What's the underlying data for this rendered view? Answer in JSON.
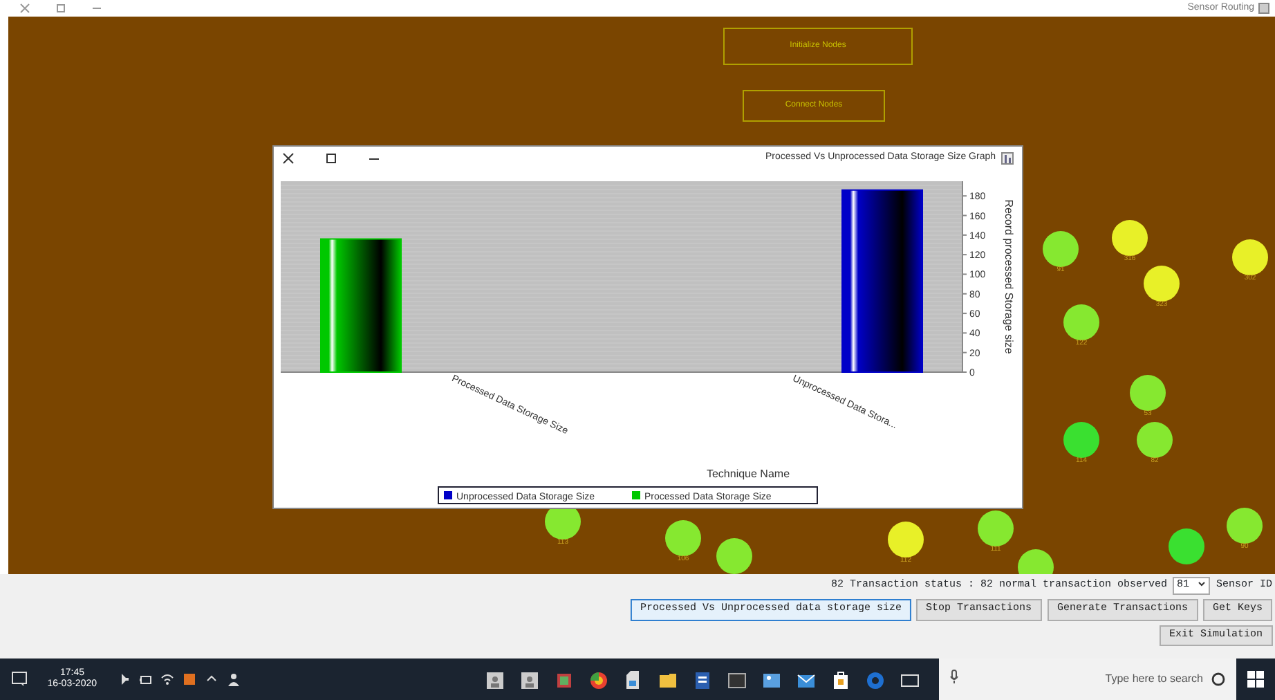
{
  "window": {
    "title": "Sensor Routing"
  },
  "canvas": {
    "buttons": [
      "Initialize Nodes",
      "Connect Nodes"
    ],
    "nodes": [
      {
        "label": "302",
        "color": "#e8f028"
      },
      {
        "label": "323",
        "color": "#e8f028"
      },
      {
        "label": "316",
        "color": "#e8f028"
      },
      {
        "label": "91",
        "color": "#86e830"
      },
      {
        "label": "122",
        "color": "#86e830"
      },
      {
        "label": "53",
        "color": "#86e830"
      },
      {
        "label": "82",
        "color": "#86e830"
      },
      {
        "label": "114",
        "color": "#3ae030"
      },
      {
        "label": "111",
        "color": "#86e830"
      },
      {
        "label": "112",
        "color": "#e8f028"
      },
      {
        "label": "106",
        "color": "#86e830"
      },
      {
        "label": "113",
        "color": "#86e830"
      },
      {
        "label": "90",
        "color": "#86e830"
      },
      {
        "color": "#3ae030"
      },
      {
        "color": "#86e830"
      },
      {
        "color": "#86e830"
      }
    ]
  },
  "chart_window": {
    "title": "Processed Vs Unprocessed Data Storage Size Graph",
    "chart_data": {
      "type": "bar",
      "xlabel": "Technique Name",
      "ylabel": "Record processed Storage size",
      "categories": [
        "Processed Data Storage Size",
        "Unprocessed Data Stora..."
      ],
      "series": [
        {
          "name": "Unprocessed Data Storage Size",
          "color": "#0000c8",
          "values": [
            null,
            186
          ]
        },
        {
          "name": "Processed Data Storage Size",
          "color": "#00c800",
          "values": [
            136,
            null
          ]
        }
      ],
      "ylim": [
        0,
        195
      ],
      "yticks": [
        0,
        20,
        40,
        60,
        80,
        100,
        120,
        140,
        160,
        180
      ],
      "grid": true,
      "legend": "bottom"
    }
  },
  "status": {
    "message": "82 Transaction status : 82 normal transaction observed",
    "sensor_value": "81",
    "sensor_label": "Sensor ID"
  },
  "buttons": [
    {
      "label": "Processed Vs Unprocessed data storage size",
      "selected": true
    },
    {
      "label": "Stop Transactions",
      "selected": false
    },
    {
      "label": "Generate Transactions",
      "selected": false
    },
    {
      "label": "Get Keys",
      "selected": false
    }
  ],
  "exit_button": "Exit Simulation",
  "taskbar": {
    "search_placeholder": "Type here to search",
    "time": "17:45",
    "date": "16-03-2020"
  }
}
